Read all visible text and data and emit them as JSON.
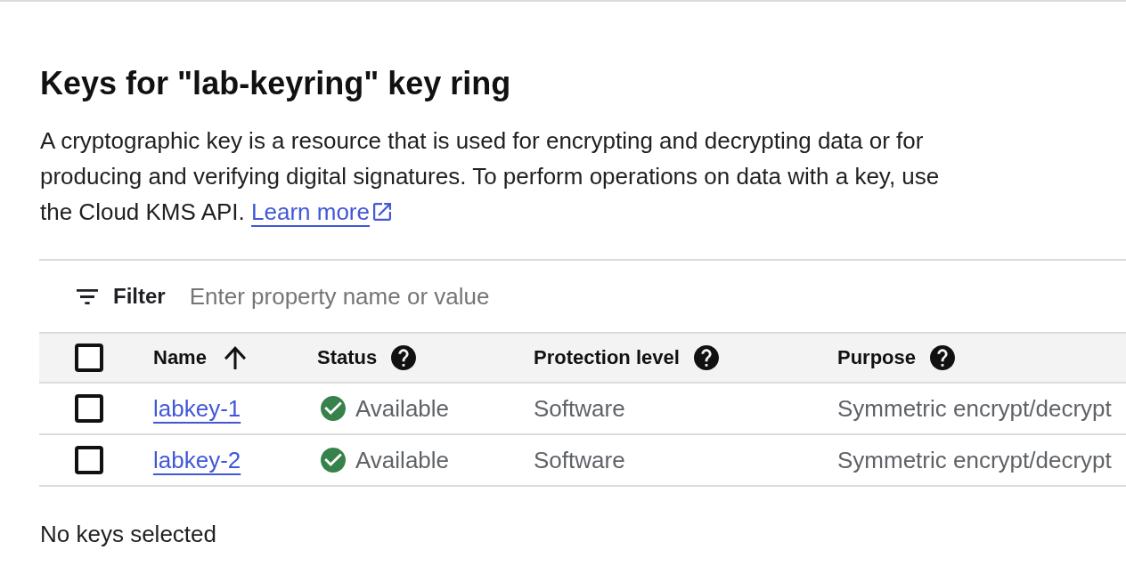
{
  "heading": "Keys for \"lab-keyring\" key ring",
  "description": {
    "text": "A cryptographic key is a resource that is used for encrypting and decrypting data or for producing and verifying digital signatures. To perform operations on data with a key, use the Cloud KMS API.",
    "link": "Learn more"
  },
  "filter": {
    "label": "Filter",
    "placeholder": "Enter property name or value"
  },
  "table": {
    "select_all": {
      "checked": false
    },
    "columns": [
      {
        "label": "Name",
        "sorted": true,
        "help": false
      },
      {
        "label": "Status",
        "sorted": false,
        "help": true
      },
      {
        "label": "Protection level",
        "sorted": false,
        "help": true
      },
      {
        "label": "Purpose",
        "sorted": false,
        "help": true
      }
    ],
    "rows": [
      {
        "checked": false,
        "name": "labkey-1",
        "status": "Available",
        "protection_level": "Software",
        "purpose": "Symmetric encrypt/decrypt"
      },
      {
        "checked": false,
        "name": "labkey-2",
        "status": "Available",
        "protection_level": "Software",
        "purpose": "Symmetric encrypt/decrypt"
      }
    ]
  },
  "selection_status": "No keys selected"
}
